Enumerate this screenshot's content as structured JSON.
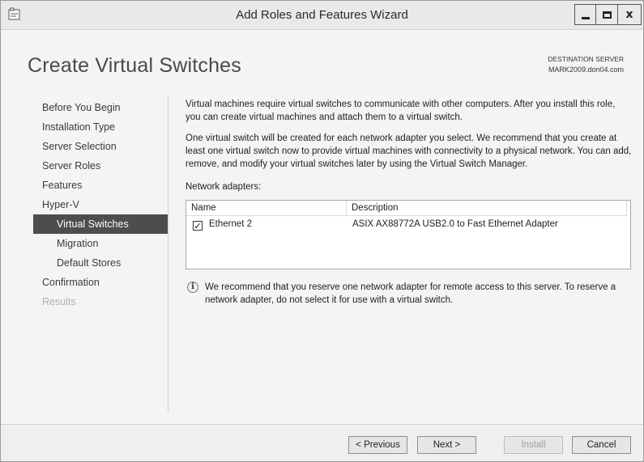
{
  "window": {
    "title": "Add Roles and Features Wizard",
    "minimize_glyph": "",
    "close_glyph": "x"
  },
  "header": {
    "page_title": "Create Virtual Switches",
    "destination_label": "DESTINATION SERVER",
    "destination_server": "MARK2009.don04.com"
  },
  "nav": {
    "items": [
      {
        "label": "Before You Begin",
        "state": "normal"
      },
      {
        "label": "Installation Type",
        "state": "normal"
      },
      {
        "label": "Server Selection",
        "state": "normal"
      },
      {
        "label": "Server Roles",
        "state": "normal"
      },
      {
        "label": "Features",
        "state": "normal"
      },
      {
        "label": "Hyper-V",
        "state": "normal"
      },
      {
        "label": "Virtual Switches",
        "state": "active"
      },
      {
        "label": "Migration",
        "state": "normal"
      },
      {
        "label": "Default Stores",
        "state": "normal"
      },
      {
        "label": "Confirmation",
        "state": "normal"
      },
      {
        "label": "Results",
        "state": "disabled"
      }
    ]
  },
  "content": {
    "para1": "Virtual machines require virtual switches to communicate with other computers. After you install this role, you can create virtual machines and attach them to a virtual switch.",
    "para2": "One virtual switch will be created for each network adapter you select. We recommend that you create at least one virtual switch now to provide virtual machines with connectivity to a physical network. You can add, remove, and modify your virtual switches later by using the Virtual Switch Manager.",
    "adapters_label": "Network adapters:",
    "table": {
      "columns": [
        "Name",
        "Description"
      ],
      "rows": [
        {
          "checked": true,
          "name": "Ethernet 2",
          "description": "ASIX AX88772A USB2.0 to Fast Ethernet Adapter"
        }
      ]
    },
    "check_glyph": "✓",
    "info_glyph": "i",
    "note": "We recommend that you reserve one network adapter for remote access to this server. To reserve a network adapter, do not select it for use with a virtual switch."
  },
  "footer": {
    "previous_label": "< Previous",
    "next_label": "Next >",
    "install_label": "Install",
    "cancel_label": "Cancel"
  }
}
